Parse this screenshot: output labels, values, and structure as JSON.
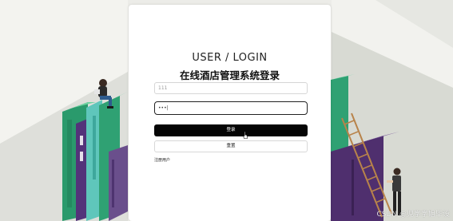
{
  "login": {
    "title_en": "USER / LOGIN",
    "title_cn": "在线酒店管理系统登录",
    "username_value": "111",
    "password_value": "•••|",
    "login_button": "登录",
    "reset_button": "重置",
    "register_link": "注册用户"
  },
  "watermark": "CSDN @児学学姐毕设",
  "colors": {
    "background": "#ecece8",
    "book_green": "#2fa173",
    "book_teal": "#5cc3b8",
    "book_purple": "#54336b",
    "ladder": "#b8834a",
    "login_button": "#050505"
  }
}
